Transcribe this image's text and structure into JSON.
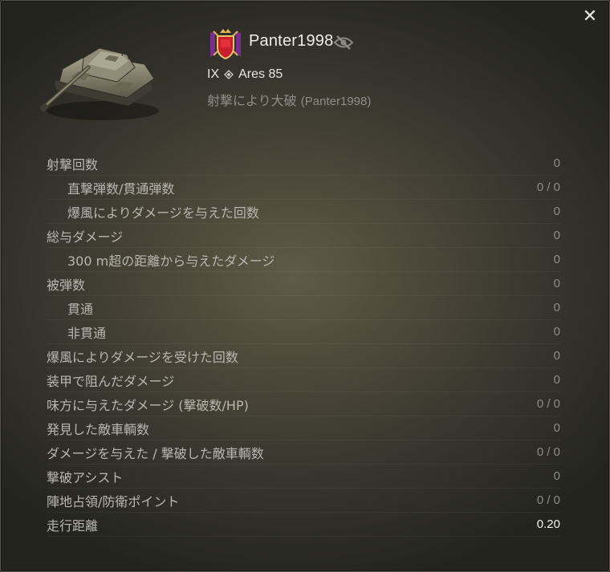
{
  "header": {
    "player_name": "Panter1998",
    "tier": "IX",
    "vehicle_name": "Ares 85",
    "fate_text": "射撃により大破",
    "fate_by": "(Panter1998)",
    "icons": {
      "close": "close-icon",
      "emblem": "clan-emblem-icon",
      "hidden": "eye-slash-icon",
      "vehicle_type": "vehicle-class-icon",
      "tank": "tank-image"
    }
  },
  "stats": [
    {
      "label": "射撃回数",
      "value": "0",
      "indent": false
    },
    {
      "label": "直撃弾数/貫通弾数",
      "value": "0 / 0",
      "indent": true
    },
    {
      "label": "爆風によりダメージを与えた回数",
      "value": "0",
      "indent": true
    },
    {
      "label": "総与ダメージ",
      "value": "0",
      "indent": false
    },
    {
      "label": "300 m超の距離から与えたダメージ",
      "value": "0",
      "indent": true
    },
    {
      "label": "被弾数",
      "value": "0",
      "indent": false
    },
    {
      "label": "貫通",
      "value": "0",
      "indent": true
    },
    {
      "label": "非貫通",
      "value": "0",
      "indent": true
    },
    {
      "label": "爆風によりダメージを受けた回数",
      "value": "0",
      "indent": false
    },
    {
      "label": "装甲で阻んだダメージ",
      "value": "0",
      "indent": false
    },
    {
      "label": "味方に与えたダメージ (撃破数/HP)",
      "value": "0 / 0",
      "indent": false
    },
    {
      "label": "発見した敵車輌数",
      "value": "0",
      "indent": false
    },
    {
      "label": "ダメージを与えた / 撃破した敵車輌数",
      "value": "0 / 0",
      "indent": false
    },
    {
      "label": "撃破アシスト",
      "value": "0",
      "indent": false
    },
    {
      "label": "陣地占領/防衛ポイント",
      "value": "0 / 0",
      "indent": false
    },
    {
      "label": "走行距離",
      "value": "0.20",
      "indent": false
    }
  ]
}
